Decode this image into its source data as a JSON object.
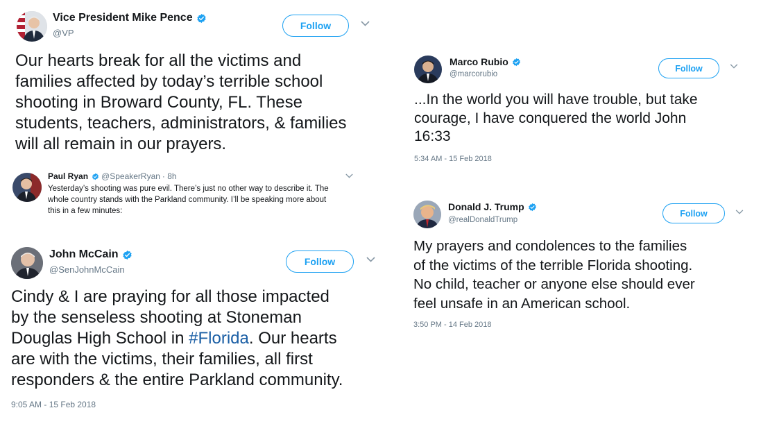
{
  "tweets": {
    "pence": {
      "name": "Vice President Mike Pence",
      "handle": "@VP",
      "follow_label": "Follow",
      "lines": [
        "Our hearts break for all the victims and",
        "families affected by today’s terrible school",
        "shooting in Broward County, FL. These",
        "students, teachers, administrators, & families",
        "will all remain in our prayers."
      ]
    },
    "ryan": {
      "name": "Paul Ryan",
      "handle": "@SpeakerRyan",
      "age": "· 8h",
      "lines": [
        "Yesterday’s shooting was pure evil. There’s just no other way to describe it. The",
        "whole country stands with the Parkland community. I’ll be speaking more about",
        "this in a few minutes:"
      ]
    },
    "mccain": {
      "name": "John McCain",
      "handle": "@SenJohnMcCain",
      "follow_label": "Follow",
      "lines": [
        "Cindy & I are praying for all those impacted",
        "by the senseless shooting at Stoneman"
      ],
      "line3_before": "Douglas High School in ",
      "hashtag": "#Florida",
      "line3_after": ". Our hearts",
      "lines_after": [
        "are with the victims, their families, all first",
        "responders & the entire Parkland community."
      ],
      "timestamp": "9:05 AM - 15 Feb 2018"
    },
    "rubio": {
      "name": "Marco Rubio",
      "handle": "@marcorubio",
      "follow_label": "Follow",
      "lines": [
        "...In the world you will have trouble, but take",
        "courage, I have conquered the world John",
        "16:33"
      ],
      "timestamp": "5:34 AM - 15 Feb 2018"
    },
    "trump": {
      "name": "Donald J. Trump",
      "handle": "@realDonaldTrump",
      "follow_label": "Follow",
      "lines": [
        "My prayers and condolences to the families",
        "of the victims of the terrible Florida shooting.",
        "No child, teacher or anyone else should ever",
        "feel unsafe in an American school."
      ],
      "timestamp": "3:50 PM - 14 Feb 2018"
    }
  },
  "icons": {
    "verified": "verified-badge-icon",
    "caret": "chevron-down-icon"
  },
  "colors": {
    "accent": "#1da1f2",
    "hashtag": "#1b5fa5",
    "text": "#14171a",
    "muted": "#657786"
  }
}
